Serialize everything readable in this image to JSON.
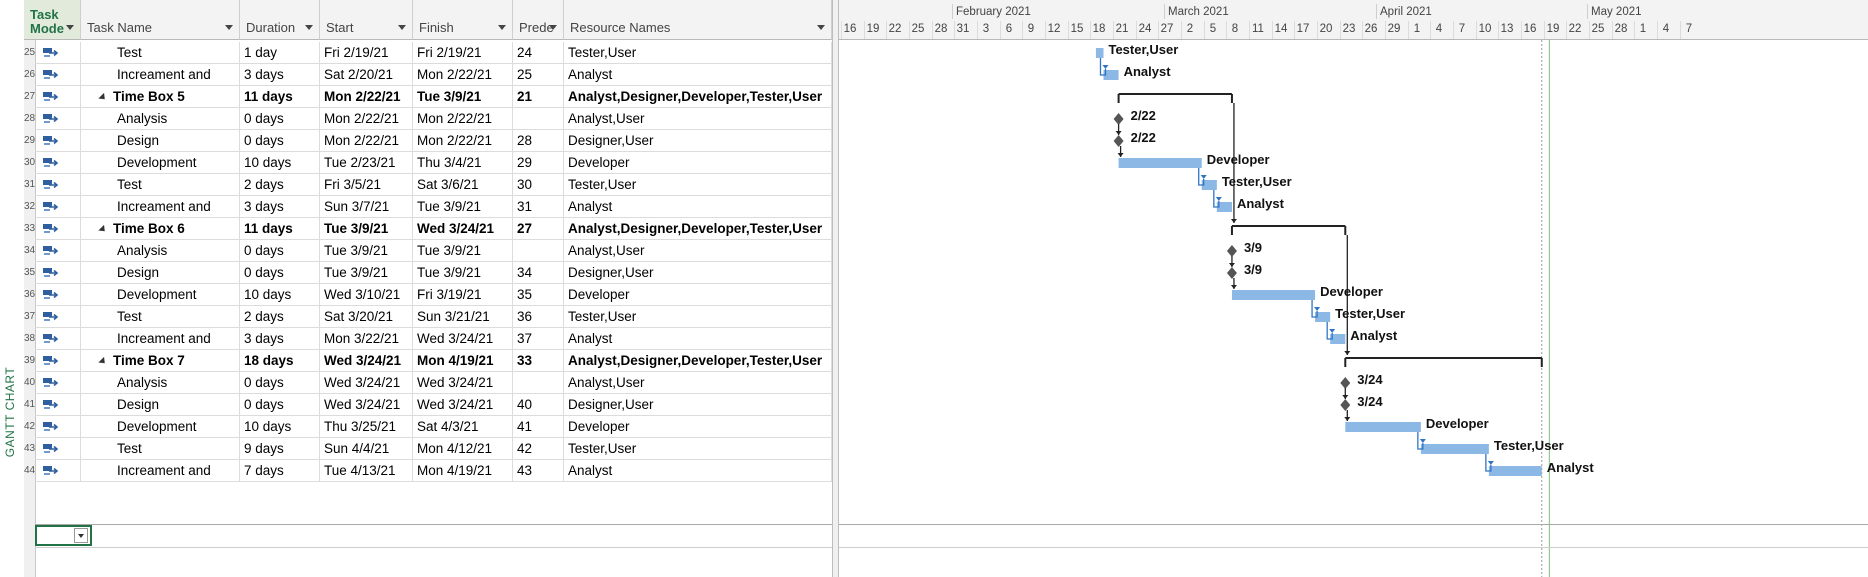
{
  "view_bar": {
    "label": "GANTT CHART"
  },
  "columns": {
    "task_mode": "Task Mode",
    "task_name": "Task Name",
    "duration": "Duration",
    "start": "Start",
    "finish": "Finish",
    "predecessors": "Prede",
    "resource_names": "Resource Names"
  },
  "tasks": [
    {
      "id": "25",
      "name": "Test",
      "duration": "1 day",
      "start": "Fri 2/19/21",
      "finish": "Fri 2/19/21",
      "pred": "24",
      "resources": "Tester,User",
      "summary": false,
      "bar_start": "2021-02-19",
      "bar_end": "2021-02-20",
      "milestone": false,
      "label": "Tester,User"
    },
    {
      "id": "26",
      "name": "Increament and",
      "duration": "3 days",
      "start": "Sat 2/20/21",
      "finish": "Mon 2/22/21",
      "pred": "25",
      "resources": "Analyst",
      "summary": false,
      "bar_start": "2021-02-20",
      "bar_end": "2021-02-22",
      "milestone": false,
      "label": "Analyst"
    },
    {
      "id": "27",
      "name": "Time Box 5",
      "duration": "11 days",
      "start": "Mon 2/22/21",
      "finish": "Tue 3/9/21",
      "pred": "21",
      "resources": "Analyst,Designer,Developer,Tester,User",
      "summary": true,
      "bar_start": "2021-02-22",
      "bar_end": "2021-03-09",
      "milestone": false,
      "label": ""
    },
    {
      "id": "28",
      "name": "Analysis",
      "duration": "0 days",
      "start": "Mon 2/22/21",
      "finish": "Mon 2/22/21",
      "pred": "",
      "resources": "Analyst,User",
      "summary": false,
      "bar_start": "2021-02-22",
      "bar_end": "2021-02-22",
      "milestone": true,
      "label": "2/22"
    },
    {
      "id": "29",
      "name": "Design",
      "duration": "0 days",
      "start": "Mon 2/22/21",
      "finish": "Mon 2/22/21",
      "pred": "28",
      "resources": "Designer,User",
      "summary": false,
      "bar_start": "2021-02-22",
      "bar_end": "2021-02-22",
      "milestone": true,
      "label": "2/22"
    },
    {
      "id": "30",
      "name": "Development",
      "duration": "10 days",
      "start": "Tue 2/23/21",
      "finish": "Thu 3/4/21",
      "pred": "29",
      "resources": "Developer",
      "summary": false,
      "bar_start": "2021-02-22",
      "bar_end": "2021-03-05",
      "milestone": false,
      "label": "Developer"
    },
    {
      "id": "31",
      "name": "Test",
      "duration": "2 days",
      "start": "Fri 3/5/21",
      "finish": "Sat 3/6/21",
      "pred": "30",
      "resources": "Tester,User",
      "summary": false,
      "bar_start": "2021-03-05",
      "bar_end": "2021-03-07",
      "milestone": false,
      "label": "Tester,User"
    },
    {
      "id": "32",
      "name": "Increament and",
      "duration": "3 days",
      "start": "Sun 3/7/21",
      "finish": "Tue 3/9/21",
      "pred": "31",
      "resources": "Analyst",
      "summary": false,
      "bar_start": "2021-03-07",
      "bar_end": "2021-03-09",
      "milestone": false,
      "label": "Analyst"
    },
    {
      "id": "33",
      "name": "Time Box 6",
      "duration": "11 days",
      "start": "Tue 3/9/21",
      "finish": "Wed 3/24/21",
      "pred": "27",
      "resources": "Analyst,Designer,Developer,Tester,User",
      "summary": true,
      "bar_start": "2021-03-09",
      "bar_end": "2021-03-24",
      "milestone": false,
      "label": ""
    },
    {
      "id": "34",
      "name": "Analysis",
      "duration": "0 days",
      "start": "Tue 3/9/21",
      "finish": "Tue 3/9/21",
      "pred": "",
      "resources": "Analyst,User",
      "summary": false,
      "bar_start": "2021-03-09",
      "bar_end": "2021-03-09",
      "milestone": true,
      "label": "3/9"
    },
    {
      "id": "35",
      "name": "Design",
      "duration": "0 days",
      "start": "Tue 3/9/21",
      "finish": "Tue 3/9/21",
      "pred": "34",
      "resources": "Designer,User",
      "summary": false,
      "bar_start": "2021-03-09",
      "bar_end": "2021-03-09",
      "milestone": true,
      "label": "3/9"
    },
    {
      "id": "36",
      "name": "Development",
      "duration": "10 days",
      "start": "Wed 3/10/21",
      "finish": "Fri 3/19/21",
      "pred": "35",
      "resources": "Developer",
      "summary": false,
      "bar_start": "2021-03-09",
      "bar_end": "2021-03-20",
      "milestone": false,
      "label": "Developer"
    },
    {
      "id": "37",
      "name": "Test",
      "duration": "2 days",
      "start": "Sat 3/20/21",
      "finish": "Sun 3/21/21",
      "pred": "36",
      "resources": "Tester,User",
      "summary": false,
      "bar_start": "2021-03-20",
      "bar_end": "2021-03-22",
      "milestone": false,
      "label": "Tester,User"
    },
    {
      "id": "38",
      "name": "Increament and",
      "duration": "3 days",
      "start": "Mon 3/22/21",
      "finish": "Wed 3/24/21",
      "pred": "37",
      "resources": "Analyst",
      "summary": false,
      "bar_start": "2021-03-22",
      "bar_end": "2021-03-24",
      "milestone": false,
      "label": "Analyst"
    },
    {
      "id": "39",
      "name": "Time Box 7",
      "duration": "18 days",
      "start": "Wed 3/24/21",
      "finish": "Mon 4/19/21",
      "pred": "33",
      "resources": "Analyst,Designer,Developer,Tester,User",
      "summary": true,
      "bar_start": "2021-03-24",
      "bar_end": "2021-04-19",
      "milestone": false,
      "label": ""
    },
    {
      "id": "40",
      "name": "Analysis",
      "duration": "0 days",
      "start": "Wed 3/24/21",
      "finish": "Wed 3/24/21",
      "pred": "",
      "resources": "Analyst,User",
      "summary": false,
      "bar_start": "2021-03-24",
      "bar_end": "2021-03-24",
      "milestone": true,
      "label": "3/24"
    },
    {
      "id": "41",
      "name": "Design",
      "duration": "0 days",
      "start": "Wed 3/24/21",
      "finish": "Wed 3/24/21",
      "pred": "40",
      "resources": "Designer,User",
      "summary": false,
      "bar_start": "2021-03-24",
      "bar_end": "2021-03-24",
      "milestone": true,
      "label": "3/24"
    },
    {
      "id": "42",
      "name": "Development",
      "duration": "10 days",
      "start": "Thu 3/25/21",
      "finish": "Sat 4/3/21",
      "pred": "41",
      "resources": "Developer",
      "summary": false,
      "bar_start": "2021-03-24",
      "bar_end": "2021-04-03",
      "milestone": false,
      "label": "Developer"
    },
    {
      "id": "43",
      "name": "Test",
      "duration": "9 days",
      "start": "Sun 4/4/21",
      "finish": "Mon 4/12/21",
      "pred": "42",
      "resources": "Tester,User",
      "summary": false,
      "bar_start": "2021-04-03",
      "bar_end": "2021-04-12",
      "milestone": false,
      "label": "Tester,User"
    },
    {
      "id": "44",
      "name": "Increament and",
      "duration": "7 days",
      "start": "Tue 4/13/21",
      "finish": "Mon 4/19/21",
      "pred": "43",
      "resources": "Analyst",
      "summary": false,
      "bar_start": "2021-04-12",
      "bar_end": "2021-04-19",
      "milestone": false,
      "label": "Analyst"
    }
  ],
  "timescale": {
    "months": [
      {
        "label": "February 2021",
        "date": "2021-01-31"
      },
      {
        "label": "March 2021",
        "date": "2021-02-28"
      },
      {
        "label": "April 2021",
        "date": "2021-03-28"
      },
      {
        "label": "May 2021",
        "date": "2021-04-25"
      }
    ],
    "days": [
      "16",
      "19",
      "22",
      "25",
      "28",
      "31",
      "3",
      "6",
      "9",
      "12",
      "15",
      "18",
      "21",
      "24",
      "27",
      "2",
      "5",
      "8",
      "11",
      "14",
      "17",
      "20",
      "23",
      "26",
      "29",
      "1",
      "4",
      "7",
      "10",
      "13",
      "16",
      "19",
      "22",
      "25",
      "28",
      "1",
      "4",
      "7"
    ],
    "first_day": "2021-01-16",
    "status_date": "2021-04-19",
    "current_date": "2021-04-20"
  },
  "colors": {
    "accent_green": "#217346",
    "bar_blue": "#8cb8e6",
    "link_blue": "#2f74c4",
    "summary_black": "#222222",
    "milestone_gray": "#555555"
  }
}
